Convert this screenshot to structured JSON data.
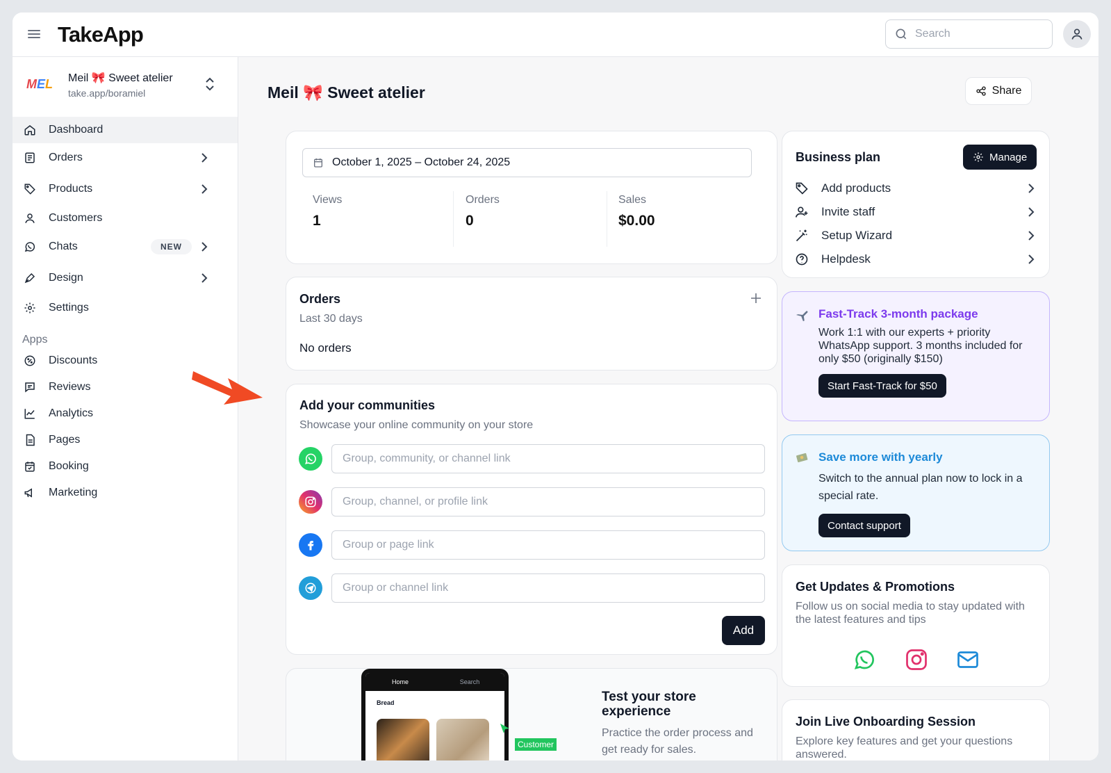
{
  "app": {
    "logo": "TakeApp",
    "search_placeholder": "Search"
  },
  "store": {
    "name": "Meil 🎀 Sweet atelier",
    "url": "take.app/boramiel",
    "logo_text": [
      "M",
      "E",
      "L"
    ]
  },
  "sidebar": {
    "items": [
      {
        "label": "Dashboard",
        "icon": "home-icon"
      },
      {
        "label": "Orders",
        "icon": "orders-icon"
      },
      {
        "label": "Products",
        "icon": "tag-icon"
      },
      {
        "label": "Customers",
        "icon": "user-icon"
      },
      {
        "label": "Chats",
        "icon": "whatsapp-icon",
        "badge": "NEW"
      },
      {
        "label": "Design",
        "icon": "pen-icon"
      },
      {
        "label": "Settings",
        "icon": "gear-icon"
      }
    ],
    "apps_heading": "Apps",
    "apps": [
      {
        "label": "Discounts",
        "icon": "discount-icon"
      },
      {
        "label": "Reviews",
        "icon": "review-icon"
      },
      {
        "label": "Analytics",
        "icon": "chart-icon"
      },
      {
        "label": "Pages",
        "icon": "page-icon"
      },
      {
        "label": "Booking",
        "icon": "calendar-icon"
      },
      {
        "label": "Marketing",
        "icon": "megaphone-icon"
      }
    ]
  },
  "main": {
    "title": "Meil 🎀 Sweet atelier",
    "share_label": "Share",
    "stats": {
      "date_range": "October 1, 2025 – October 24, 2025",
      "views_label": "Views",
      "views_value": "1",
      "orders_label": "Orders",
      "orders_value": "0",
      "sales_label": "Sales",
      "sales_value": "$0.00"
    },
    "orders": {
      "title": "Orders",
      "subtitle": "Last 30 days",
      "empty": "No orders"
    },
    "communities": {
      "title": "Add your communities",
      "subtitle": "Showcase your online community on your store",
      "fields": [
        {
          "placeholder": "Group, community, or channel link",
          "icon": "whatsapp-icon"
        },
        {
          "placeholder": "Group, channel, or profile link",
          "icon": "instagram-icon"
        },
        {
          "placeholder": "Group or page link",
          "icon": "facebook-icon"
        },
        {
          "placeholder": "Group or channel link",
          "icon": "telegram-icon"
        }
      ],
      "add_label": "Add"
    },
    "test_store": {
      "title": "Test your store experience",
      "subtitle": "Practice the order process and get ready for sales.",
      "phone_tabs": [
        "Home",
        "Search"
      ],
      "phone_category": "Bread",
      "customer_tag": "Customer"
    }
  },
  "right": {
    "plan": {
      "title": "Business plan",
      "manage_label": "Manage",
      "items": [
        {
          "label": "Add products",
          "icon": "tag-icon"
        },
        {
          "label": "Invite staff",
          "icon": "user-plus-icon"
        },
        {
          "label": "Setup Wizard",
          "icon": "magic-wand-icon"
        },
        {
          "label": "Helpdesk",
          "icon": "help-circle-icon"
        }
      ]
    },
    "fasttrack": {
      "title": "Fast-Track 3-month package",
      "text": "Work 1:1 with our experts + priority WhatsApp support. 3 months included for only $50 (originally $150)",
      "button": "Start Fast-Track for $50",
      "accent": "#7c3aed"
    },
    "yearly": {
      "title": "Save more with yearly",
      "text": "Switch to the annual plan now to lock in a special rate.",
      "button": "Contact support",
      "accent": "#1d8ad8"
    },
    "updates": {
      "title": "Get Updates & Promotions",
      "text": "Follow us on social media to stay updated with the latest features and tips"
    },
    "onboarding": {
      "title": "Join Live Onboarding Session",
      "text": "Explore key features and get your questions answered."
    }
  }
}
